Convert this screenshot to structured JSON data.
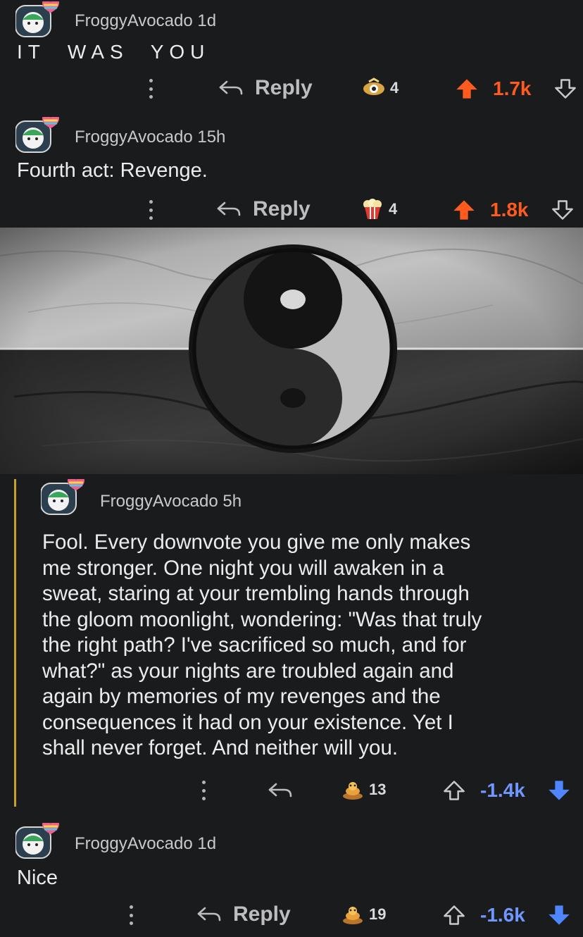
{
  "comments": [
    {
      "username": "FroggyAvocado",
      "age": "1d",
      "body": "IT  WAS  YOU",
      "reply_label": "Reply",
      "award_count": "4",
      "score": "1.7k"
    },
    {
      "username": "FroggyAvocado",
      "age": "15h",
      "body": "Fourth act: Revenge.",
      "reply_label": "Reply",
      "award_count": "4",
      "score": "1.8k"
    },
    {
      "username": "FroggyAvocado",
      "age": "5h",
      "body_lines": [
        "Fool. Every downvote you give me only makes",
        "me stronger. One night you will awaken in a",
        "sweat, staring at your trembling hands through",
        "the gloom moonlight, wondering: \"Was that truly",
        "the right path? I've sacrificed so much, and for",
        "what?\" as your nights are troubled again and",
        "again by memories of my revenges and the",
        "consequences it had on your existence. Yet I",
        "shall never forget. And neither will you."
      ],
      "award_count": "13",
      "score": "-1.4k"
    },
    {
      "username": "FroggyAvocado",
      "age": "1d",
      "body": "Nice",
      "reply_label": "Reply",
      "award_count": "19",
      "score": "-1.6k"
    }
  ],
  "colors": {
    "background": "#1a1b1d",
    "upvote": "#ff5b1f",
    "downvote": "#6f97ff",
    "thread_line": "#c7a128"
  },
  "icons": [
    "more-icon",
    "reply-icon",
    "award-icon",
    "upvote-icon",
    "downvote-icon",
    "avatar-icon",
    "yin-yang-image"
  ]
}
